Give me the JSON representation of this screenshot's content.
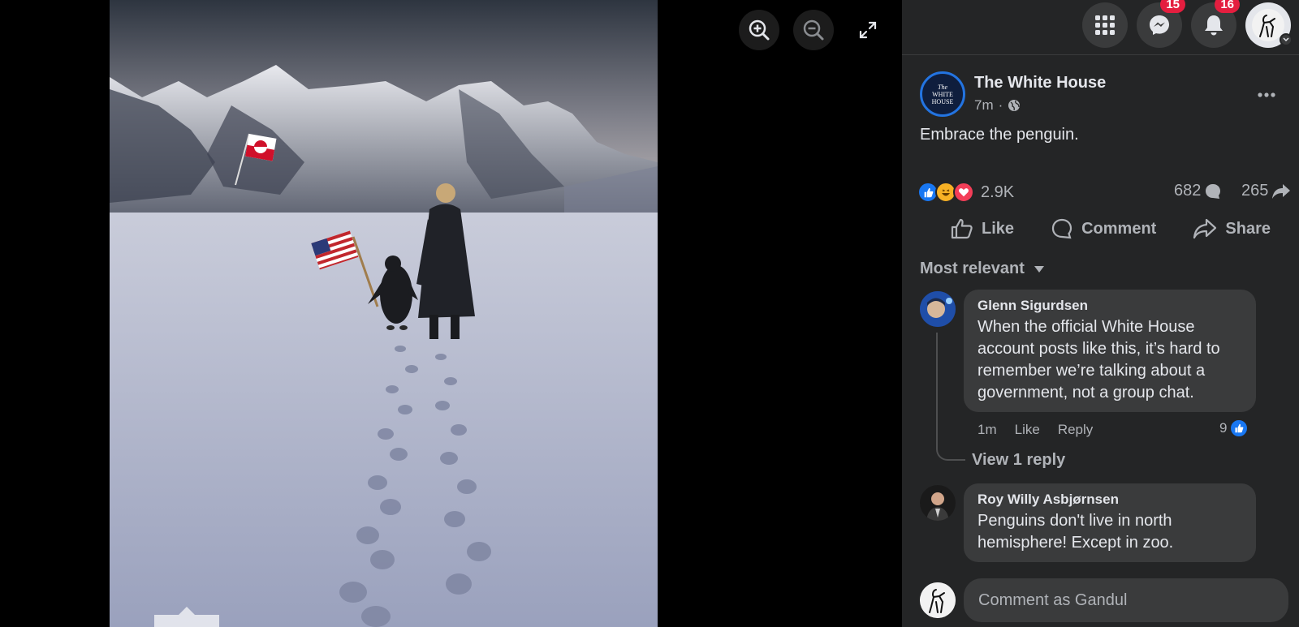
{
  "viewer": {
    "zoom_in_label": "Zoom in",
    "zoom_out_label": "Zoom out",
    "fullscreen_label": "Fullscreen"
  },
  "topbar": {
    "messenger_badge": "15",
    "notifications_badge": "16"
  },
  "post": {
    "page_name": "The White House",
    "avatar_text": [
      "The",
      "WHITE",
      "HOUSE"
    ],
    "time": "7m",
    "separator": "·",
    "text": "Embrace the penguin.",
    "reactions_count": "2.9K",
    "comments_count": "682",
    "shares_count": "265"
  },
  "actions": {
    "like": "Like",
    "comment": "Comment",
    "share": "Share"
  },
  "sort_label": "Most relevant",
  "comments": [
    {
      "author": "Glenn Sigurdsen",
      "text": "When the official White House account posts like this, it’s hard to remember we’re talking about a government, not a group chat.",
      "time": "1m",
      "like": "Like",
      "reply": "Reply",
      "likes": "9",
      "view_replies": "View 1 reply"
    },
    {
      "author": "Roy Willy Asbjørnsen",
      "text": "Penguins don't live in north hemisphere! Except in zoo."
    }
  ],
  "composer": {
    "placeholder": "Comment as Gandul"
  },
  "colors": {
    "panel_bg": "#242526",
    "bubble_bg": "#3a3b3c",
    "accent_blue": "#2374e1",
    "badge_red": "#e41e3f"
  }
}
